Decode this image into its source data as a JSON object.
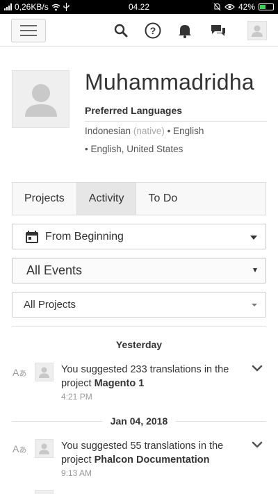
{
  "status_bar": {
    "network_speed": "0,26KB/s",
    "time": "04.22",
    "battery": "42%",
    "battery_level": 0.42
  },
  "nav": {
    "icons": [
      "menu-icon",
      "search-icon",
      "help-icon",
      "bell-icon",
      "chat-icon",
      "user-icon"
    ]
  },
  "profile": {
    "name": "Muhammadridha",
    "preferred_languages_title": "Preferred Languages",
    "lang1": "Indonesian",
    "lang1_note": "(native)",
    "lang2": "English",
    "lang3": "English, United States"
  },
  "tabs": [
    {
      "label": "Projects",
      "active": false
    },
    {
      "label": "Activity",
      "active": true
    },
    {
      "label": "To Do",
      "active": false
    }
  ],
  "filters": {
    "date": "From Beginning",
    "events": "All Events",
    "projects": "All Projects"
  },
  "feed": {
    "groups": [
      {
        "date": "Yesterday",
        "events": [
          {
            "prefix": "You suggested 233 translations in the project ",
            "project": "Magento 1",
            "time": "4:21 PM"
          }
        ]
      },
      {
        "date": "Jan 04, 2018",
        "events": [
          {
            "prefix": "You suggested 55 translations in the project ",
            "project": "Phalcon Documentation",
            "time": "9:13 AM"
          }
        ]
      }
    ]
  },
  "colors": {
    "status_bar_bg": "#000000",
    "battery_fill": "#39d353",
    "tab_active_bg": "#e6e6e6",
    "muted_text": "#999999"
  }
}
